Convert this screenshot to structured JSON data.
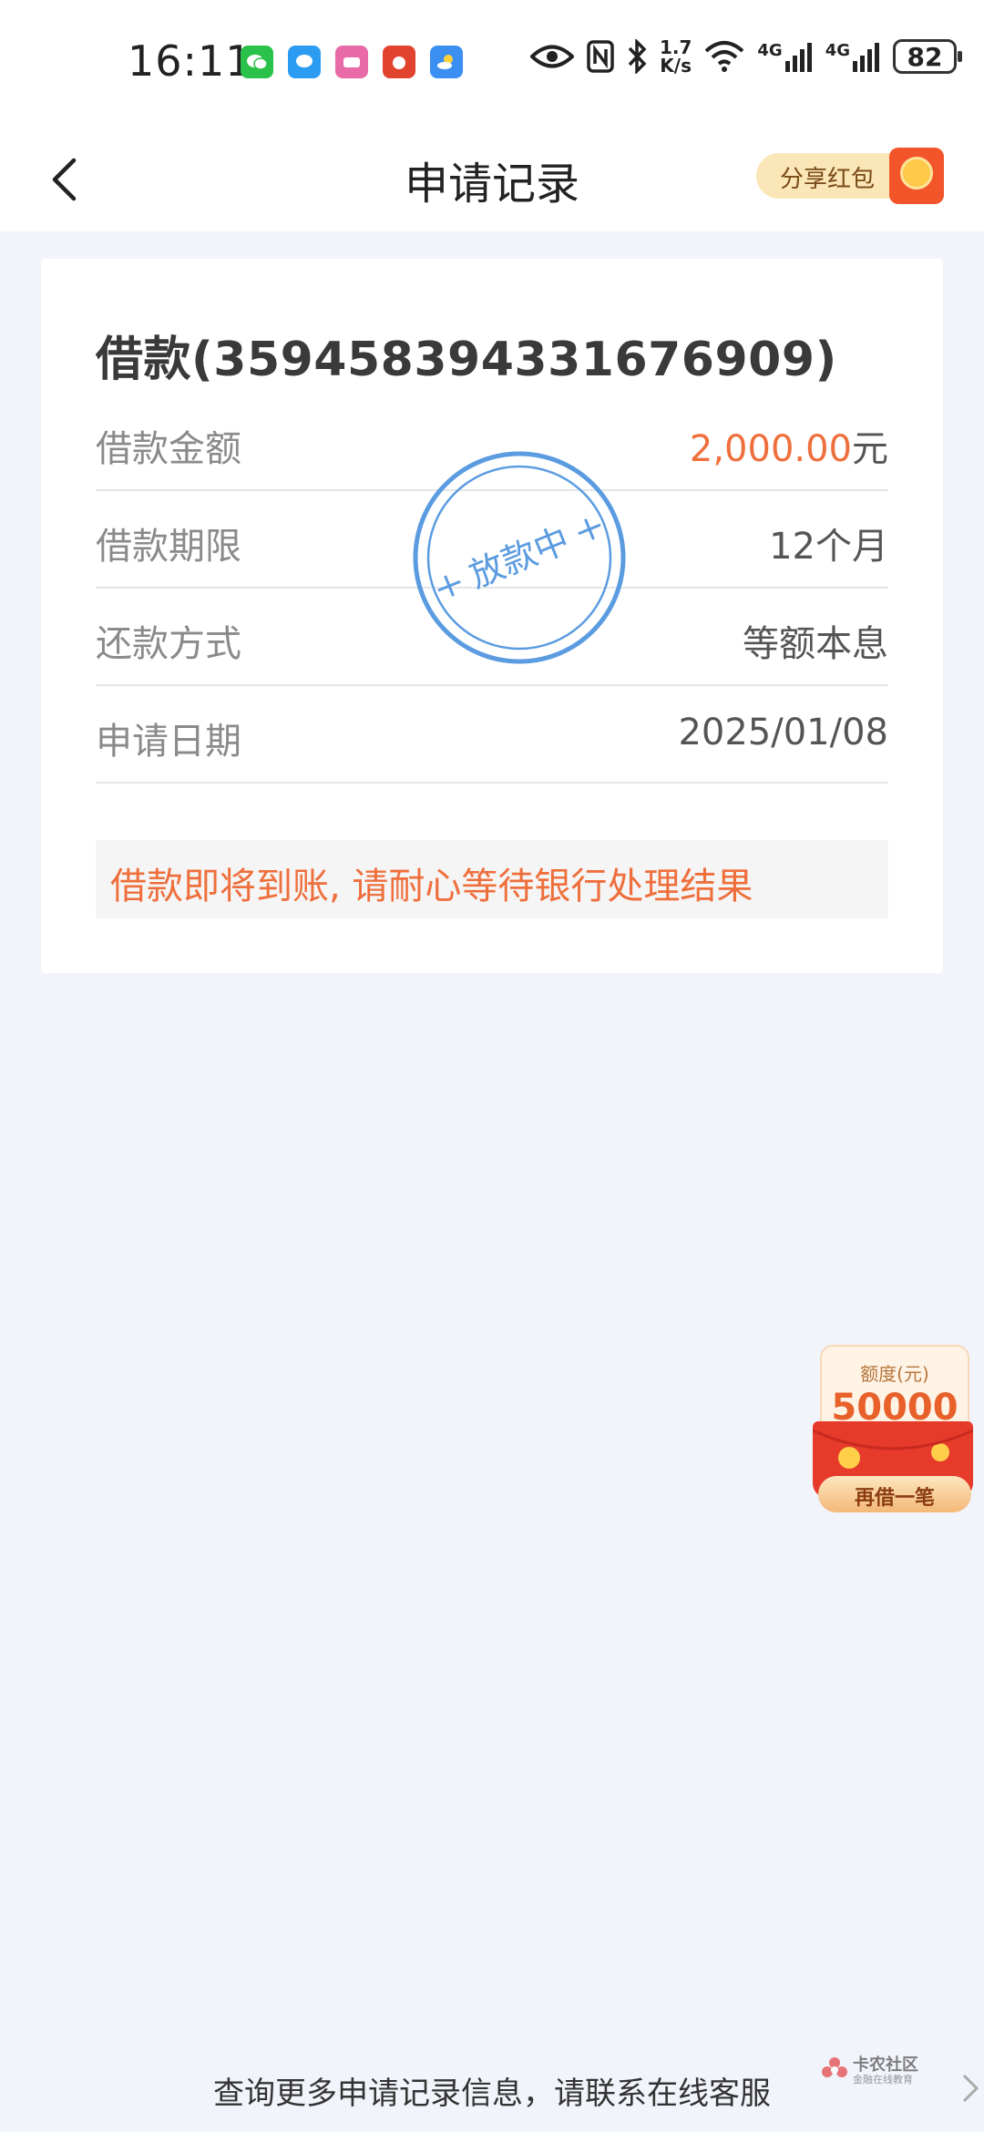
{
  "status_bar": {
    "time": "16:11",
    "net_speed_top": "1.7",
    "net_speed_bottom": "K/s",
    "net1": "4G",
    "net2": "4G",
    "battery": "82"
  },
  "header": {
    "title": "申请记录",
    "share_label": "分享红包"
  },
  "loan": {
    "title": "借款(359458394331676909)",
    "rows": [
      {
        "label": "借款金额",
        "amount": "2,000.00",
        "unit": "元"
      },
      {
        "label": "借款期限",
        "value": "12个月"
      },
      {
        "label": "还款方式",
        "value": "等额本息"
      },
      {
        "label": "申请日期",
        "value": "2025/01/08"
      }
    ],
    "stamp_text": "放款中",
    "notice": "借款即将到账, 请耐心等待银行处理结果"
  },
  "float_badge": {
    "label": "额度(元)",
    "value": "50000",
    "button": "再借一笔"
  },
  "footer": {
    "text": "查询更多申请记录信息，请联系在线客服",
    "watermark_name": "卡农社区",
    "watermark_sub": "金融在线教育"
  },
  "colors": {
    "accent_orange": "#ef6f3c",
    "stamp_blue": "#5b9be0",
    "background": "#f2f4fb"
  }
}
